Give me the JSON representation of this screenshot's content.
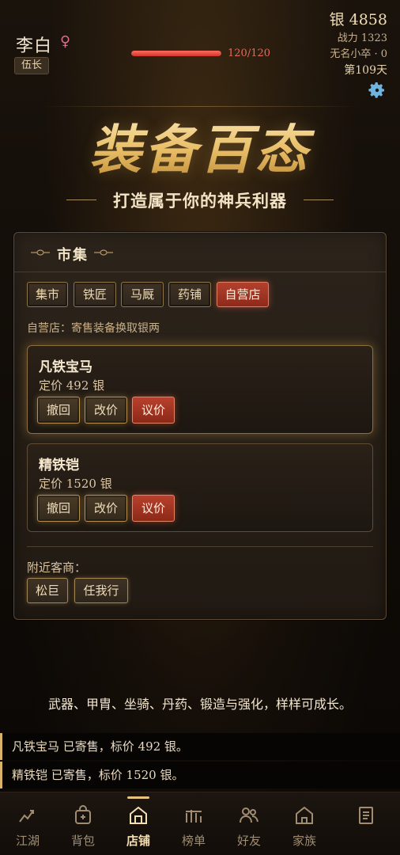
{
  "player": {
    "name": "李白",
    "gender_symbol": "♀",
    "rank": "伍长",
    "hp_text": "120/120",
    "hp_fraction": 1.0
  },
  "stats": {
    "silver": "银 4858",
    "power": "战力 1323",
    "title": "无名小卒 · 0",
    "day": "第109天"
  },
  "banner": {
    "title": "装备百态",
    "subtitle": "打造属于你的神兵利器"
  },
  "market": {
    "title": "市集",
    "tabs": [
      {
        "label": "集市"
      },
      {
        "label": "铁匠"
      },
      {
        "label": "马厩"
      },
      {
        "label": "药铺"
      },
      {
        "label": "自营店",
        "active": true
      }
    ],
    "shop_desc": "自营店：寄售装备换取银两",
    "items": [
      {
        "name": "凡铁宝马",
        "price": "定价 492 银",
        "buttons": [
          "撤回",
          "改价",
          "议价"
        ]
      },
      {
        "name": "精铁铠",
        "price": "定价 1520 银",
        "buttons": [
          "撤回",
          "改价",
          "议价"
        ]
      }
    ],
    "nearby_label": "附近客商：",
    "merchants": [
      "松巨",
      "任我行"
    ]
  },
  "tagline": "武器、甲胄、坐骑、丹药、锻造与强化，样样可成长。",
  "log": [
    "凡铁宝马 已寄售，标价 492 银。",
    "精铁铠 已寄售，标价 1520 银。"
  ],
  "nav": [
    {
      "label": "江湖",
      "icon": "chart-icon"
    },
    {
      "label": "背包",
      "icon": "bag-icon"
    },
    {
      "label": "店铺",
      "icon": "shop-icon",
      "active": true
    },
    {
      "label": "榜单",
      "icon": "ranking-icon"
    },
    {
      "label": "好友",
      "icon": "friends-icon"
    },
    {
      "label": "家族",
      "icon": "clan-icon"
    },
    {
      "label": "",
      "icon": "log-icon"
    }
  ],
  "colors": {
    "accent_gold": "#e8c27a",
    "active_red": "#b4402d",
    "hp_red": "#d3352e",
    "background": "#140f0a"
  }
}
